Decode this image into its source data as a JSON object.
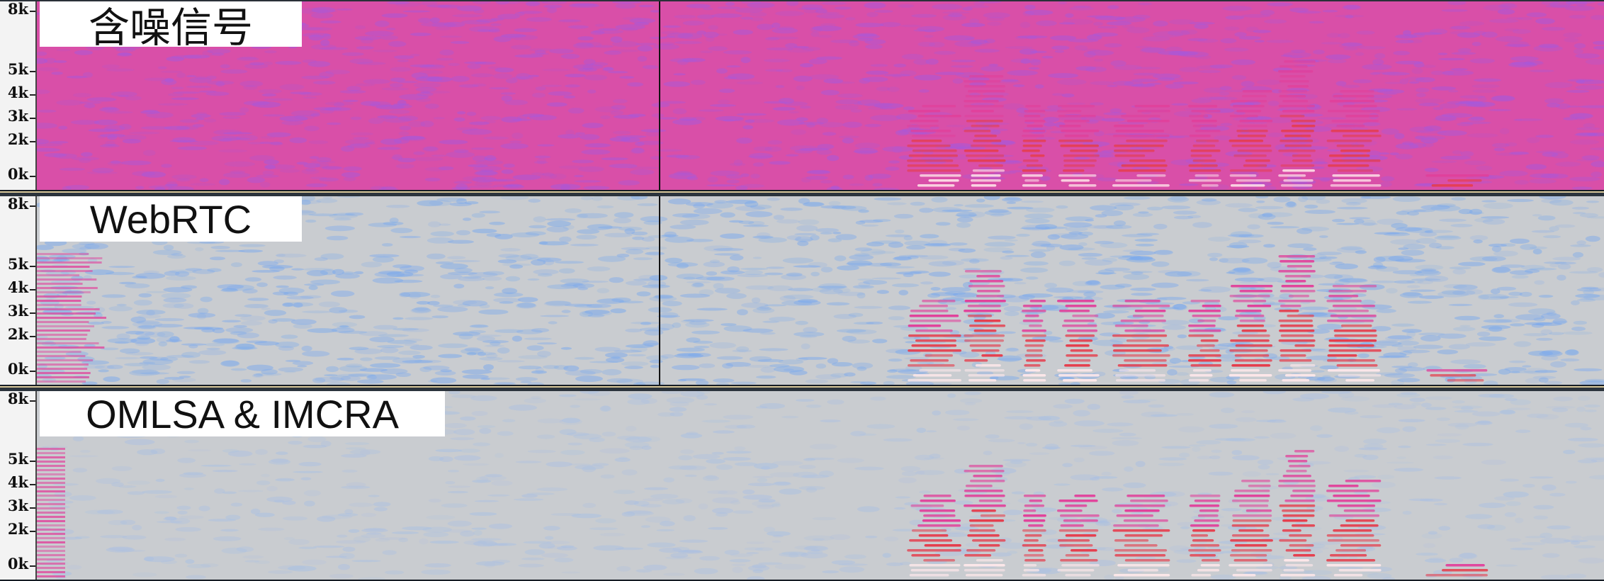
{
  "window": {
    "title": ""
  },
  "y_axis_ticks": [
    "8k",
    "5k",
    "4k",
    "3k",
    "2k",
    "0k"
  ],
  "tracks": [
    {
      "label": "含噪信号",
      "background_color": "#d94fa8",
      "noise_color": "#a25ae0"
    },
    {
      "label": "WebRTC",
      "background_color": "#c9ccd0",
      "noise_color": "#78a8ee"
    },
    {
      "label": "OMLSA & IMCRA",
      "background_color": "#c9ccd0",
      "noise_color": "#a8bfe4"
    }
  ],
  "colors": {
    "speech_low": "#e1409a",
    "speech_mid": "#e53d4c",
    "speech_high": "#ffe8ea",
    "frame_dark": "#1b2129",
    "separator_gold": "#d8c89a"
  }
}
